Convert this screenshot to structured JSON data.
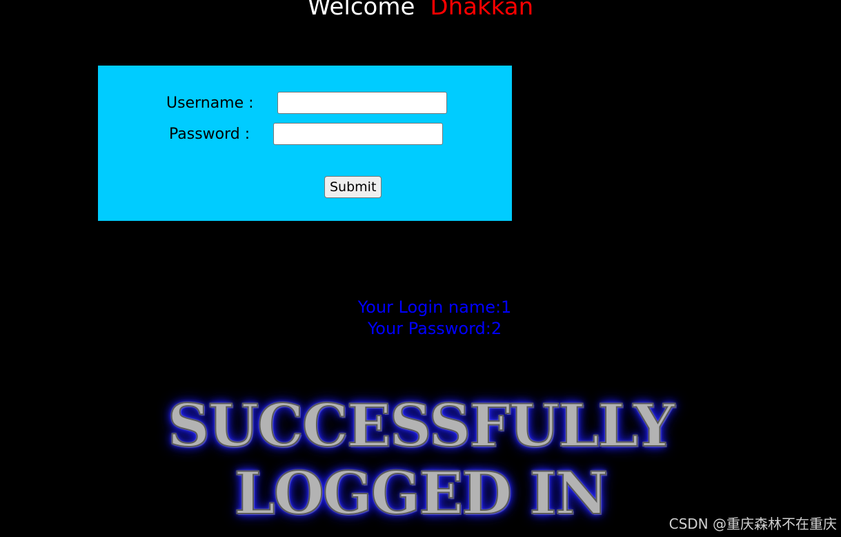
{
  "header": {
    "welcome_label": "Welcome",
    "user_name": "Dhakkan"
  },
  "login_form": {
    "username_label": "Username :",
    "username_value": "",
    "password_label": "Password :",
    "password_value": "",
    "submit_label": "Submit"
  },
  "result": {
    "login_name_line": "Your Login name:1",
    "password_line": "Your Password:2"
  },
  "banner": {
    "line1": "SUCCESSFULLY",
    "line2": "LOGGED IN"
  },
  "watermark": "CSDN @重庆森林不在重庆",
  "colors": {
    "background": "#000000",
    "form_background": "#00ccff",
    "welcome_text": "#ffffff",
    "name_text": "#ff0000",
    "result_text": "#0000ff"
  }
}
